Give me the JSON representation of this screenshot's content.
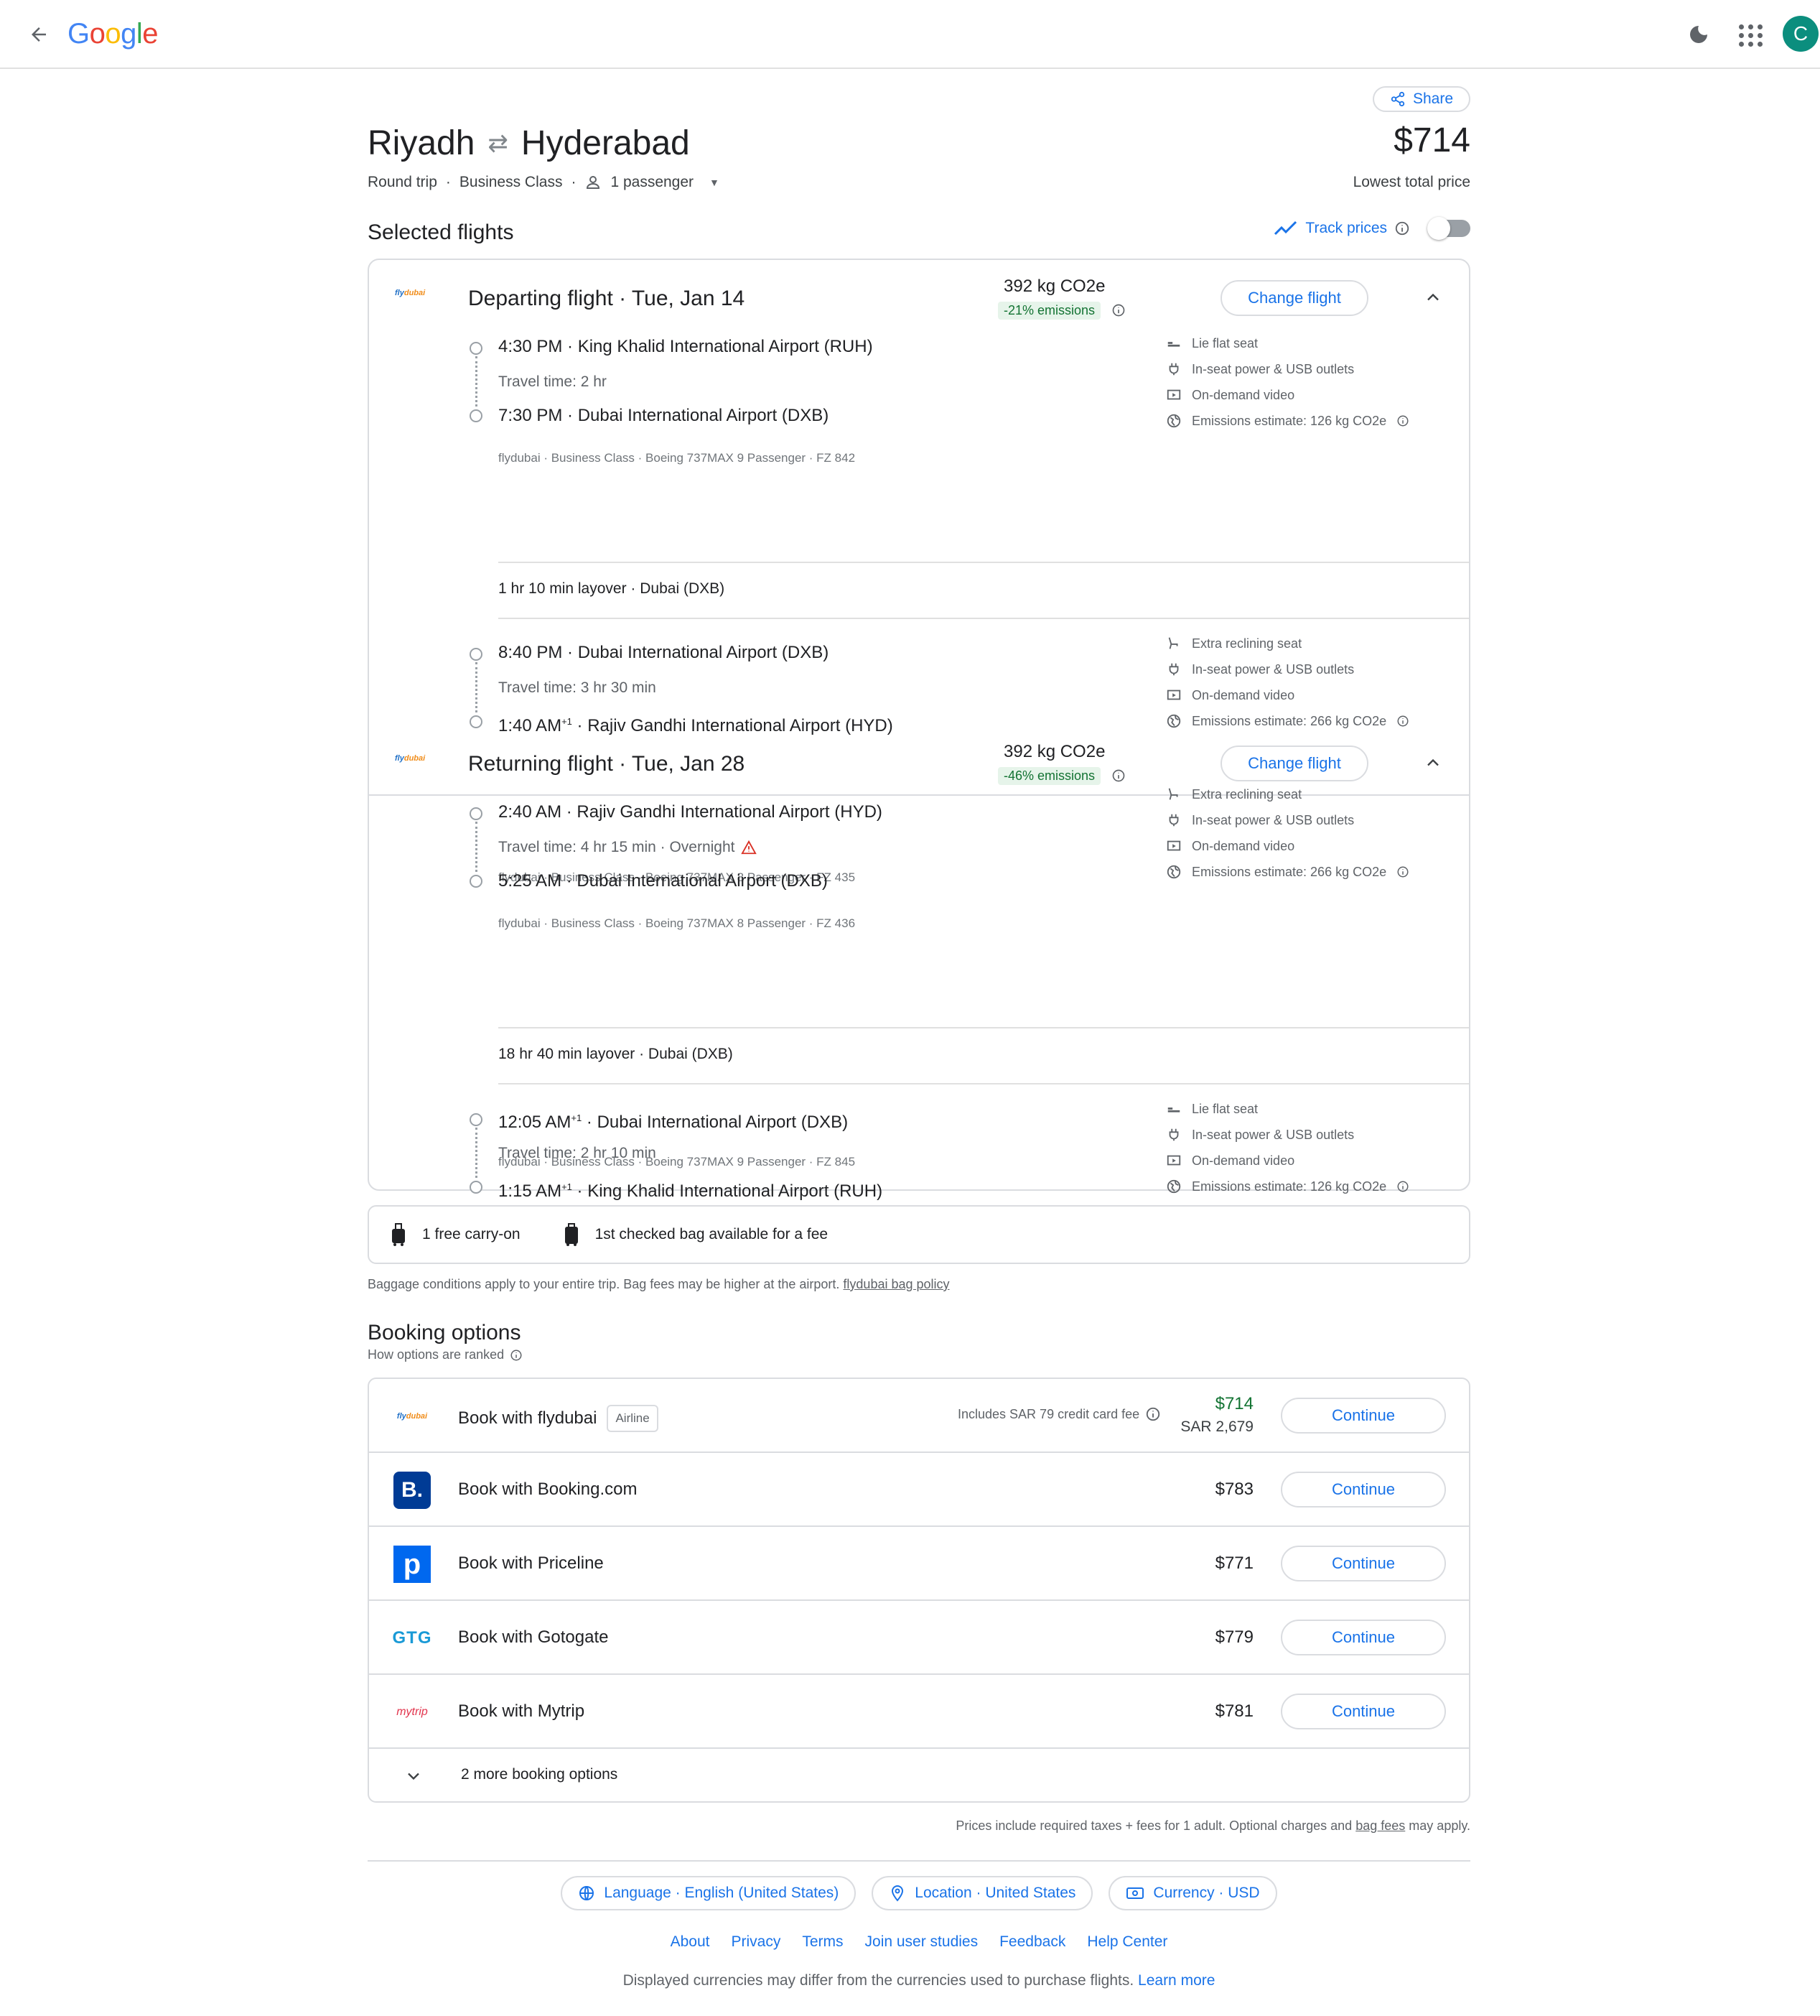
{
  "header": {
    "logo": "Google",
    "avatar_letter": "C"
  },
  "trip": {
    "origin": "Riyadh",
    "destination": "Hyderabad",
    "trip_type": "Round trip",
    "cabin": "Business Class",
    "passengers": "1 passenger",
    "share_label": "Share",
    "price": "$714",
    "price_caption": "Lowest total price"
  },
  "selected": {
    "title": "Selected flights",
    "track_label": "Track prices"
  },
  "legs": [
    {
      "airline_logo": "flydubai",
      "title": "Departing flight",
      "date": "Tue, Jan 14",
      "co2": "392 kg CO2e",
      "emissions": "-21% emissions",
      "change_label": "Change flight",
      "segments": [
        {
          "dep_time": "4:30 PM",
          "dep_airport": "King Khalid International Airport (RUH)",
          "travel": "Travel time: 2 hr",
          "arr_time": "7:30 PM",
          "arr_airport": "Dubai International Airport (DXB)",
          "info": "flydubai · Business Class · Boeing 737MAX 9 Passenger · FZ 842",
          "amenities": [
            "Lie flat seat",
            "In-seat power & USB outlets",
            "On-demand video",
            "Emissions estimate: 126 kg CO2e"
          ]
        },
        {
          "dep_time": "8:40 PM",
          "dep_airport": "Dubai International Airport (DXB)",
          "travel": "Travel time: 3 hr 30 min",
          "arr_time": "1:40 AM",
          "arr_sup": "+1",
          "arr_airport": "Rajiv Gandhi International Airport (HYD)",
          "info": "flydubai · Business Class · Boeing 737MAX 8 Passenger · FZ 435",
          "amenities": [
            "Extra reclining seat",
            "In-seat power & USB outlets",
            "On-demand video",
            "Emissions estimate: 266 kg CO2e"
          ]
        }
      ],
      "layover": "1 hr 10 min layover · Dubai (DXB)"
    },
    {
      "airline_logo": "flydubai",
      "title": "Returning flight",
      "date": "Tue, Jan 28",
      "co2": "392 kg CO2e",
      "emissions": "-46% emissions",
      "change_label": "Change flight",
      "segments": [
        {
          "dep_time": "2:40 AM",
          "dep_airport": "Rajiv Gandhi International Airport (HYD)",
          "travel": "Travel time: 4 hr 15 min · Overnight",
          "arr_time": "5:25 AM",
          "arr_airport": "Dubai International Airport (DXB)",
          "info": "flydubai · Business Class · Boeing 737MAX 8 Passenger · FZ 436",
          "amenities": [
            "Extra reclining seat",
            "In-seat power & USB outlets",
            "On-demand video",
            "Emissions estimate: 266 kg CO2e"
          ]
        },
        {
          "dep_time": "12:05 AM",
          "dep_sup": "+1",
          "dep_airport": "Dubai International Airport (DXB)",
          "travel": "Travel time: 2 hr 10 min",
          "arr_time": "1:15 AM",
          "arr_sup": "+1",
          "arr_airport": "King Khalid International Airport (RUH)",
          "info": "flydubai · Business Class · Boeing 737MAX 9 Passenger · FZ 845",
          "amenities": [
            "Lie flat seat",
            "In-seat power & USB outlets",
            "On-demand video",
            "Emissions estimate: 126 kg CO2e"
          ]
        }
      ],
      "layover": "18 hr 40 min layover · Dubai (DXB)"
    }
  ],
  "baggage": {
    "carry_on": "1 free carry-on",
    "checked": "1st checked bag available for a fee",
    "note": "Baggage conditions apply to your entire trip. Bag fees may be higher at the airport.",
    "policy_link": "flydubai bag policy"
  },
  "booking": {
    "title": "Booking options",
    "ranking_link": "How options are ranked",
    "options": [
      {
        "name": "Book with flydubai",
        "tag": "Airline",
        "fee_note": "Includes SAR 79 credit card fee",
        "price": "$714",
        "price_local": "SAR 2,679",
        "action": "Continue",
        "logo": "flydubai"
      },
      {
        "name": "Book with Booking.com",
        "price": "$783",
        "action": "Continue",
        "logo": "B."
      },
      {
        "name": "Book with Priceline",
        "price": "$771",
        "action": "Continue",
        "logo": "p"
      },
      {
        "name": "Book with Gotogate",
        "price": "$779",
        "action": "Continue",
        "logo": "GTG"
      },
      {
        "name": "Book with Mytrip",
        "price": "$781",
        "action": "Continue",
        "logo": "mytrip"
      }
    ],
    "more": "2 more booking options",
    "taxes_note": "Prices include required taxes + fees for 1 adult. Optional charges and",
    "bag_fees_link": "bag fees",
    "taxes_note_end": "may apply."
  },
  "footer": {
    "language": "Language · English (United States)",
    "location": "Location · United States",
    "currency": "Currency · USD",
    "links": [
      "About",
      "Privacy",
      "Terms",
      "Join user studies",
      "Feedback",
      "Help Center"
    ],
    "note": "Displayed currencies may differ from the currencies used to purchase flights.",
    "learn_more": "Learn more"
  },
  "colors": {
    "accent": "#1a73e8",
    "green": "#137333",
    "avatar": "#0b8e7e"
  }
}
